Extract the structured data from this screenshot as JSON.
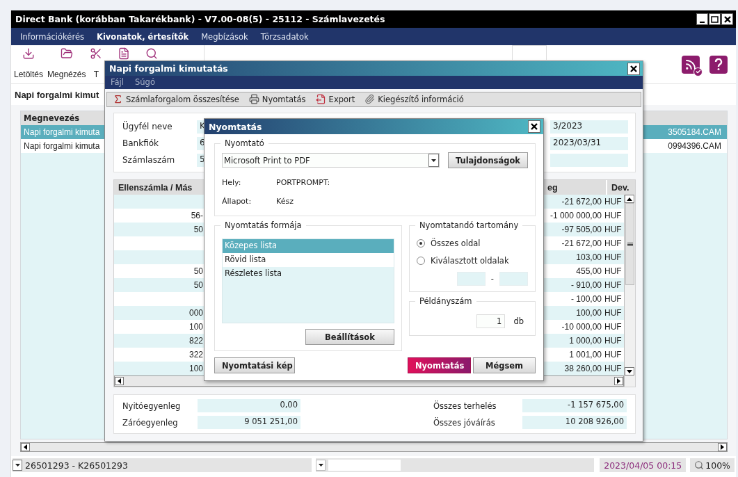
{
  "window": {
    "title": "Direct Bank (korábban Takarékbank) - V7.00-08(5) - 25112 - Számlavezetés"
  },
  "menu": [
    {
      "label": "Információkérés",
      "selected": false
    },
    {
      "label": "Kivonatok, értesítők",
      "selected": true
    },
    {
      "label": "Megbízások",
      "selected": false
    },
    {
      "label": "Törzsadatok",
      "selected": false
    }
  ],
  "toolbar": [
    {
      "kind": "download",
      "label": "Letöltés"
    },
    {
      "kind": "folder",
      "label": "Megnézés"
    },
    {
      "kind": "cut",
      "label": "T"
    },
    {
      "kind": "document"
    },
    {
      "kind": "search"
    }
  ],
  "section_title": "Napi forgalmi kimut",
  "list": {
    "columns": [
      "Megnevezés"
    ],
    "rows": [
      {
        "name": "Napi forgalmi kimuta",
        "file": "3505184.CAM",
        "selected": true
      },
      {
        "name": "Napi forgalmi kimuta",
        "file": "0994396.CAM",
        "selected": false
      }
    ]
  },
  "status_bar": {
    "account": "26501293 - K26501293",
    "datetime": "2023/04/05 00:15",
    "zoom": "100%"
  },
  "report_window": {
    "title": "Napi forgalmi kimutatás",
    "menu": [
      "Fájl",
      "Súgó"
    ],
    "toolbar": [
      {
        "kind": "sum",
        "label": "Számlaforgalom összesítése"
      },
      {
        "kind": "print",
        "label": "Nyomtatás"
      },
      {
        "kind": "export",
        "label": "Export"
      },
      {
        "kind": "attach",
        "label": "Kiegészítő információ"
      }
    ],
    "info": [
      {
        "label": "Ügyfél neve",
        "value": "K",
        "right": "3/2023"
      },
      {
        "label": "Bankfiók",
        "value": "6",
        "right": "2023/03/31"
      },
      {
        "label": "Számlaszám",
        "value": "5"
      }
    ],
    "table": {
      "columns": [
        "Ellenszámla / Más",
        "eg",
        "Dev."
      ],
      "rows": [
        {
          "account": "",
          "amount": "-21 672,00",
          "currency": "HUF"
        },
        {
          "account": "56-",
          "amount": "-1 000 000,00",
          "currency": "HUF"
        },
        {
          "account": "50",
          "amount": "-97 505,00",
          "currency": "HUF"
        },
        {
          "account": "",
          "amount": "-21 672,00",
          "currency": "HUF"
        },
        {
          "account": "",
          "amount": "103,00",
          "currency": "HUF"
        },
        {
          "account": "50",
          "amount": "455,00",
          "currency": "HUF"
        },
        {
          "account": "50",
          "amount": "- 910,00",
          "currency": "HUF"
        },
        {
          "account": "",
          "amount": "- 100,00",
          "currency": "HUF"
        },
        {
          "account": "000",
          "amount": "100,00",
          "currency": "HUF"
        },
        {
          "account": "100",
          "amount": "-10 000,00",
          "currency": "HUF"
        },
        {
          "account": "822",
          "amount": "1 000,00",
          "currency": "HUF"
        },
        {
          "account": "322",
          "amount": "1 001,00",
          "currency": "HUF"
        },
        {
          "account": "100",
          "amount": "38 260,00",
          "currency": "HUF"
        }
      ]
    },
    "summary": [
      {
        "label": "Nyitóegyenleg",
        "value": "0,00"
      },
      {
        "label": "Záróegyenleg",
        "value": "9 051 251,00"
      },
      {
        "label": "Összes terhelés",
        "value": "-1 157 675,00"
      },
      {
        "label": "Összes jóváírás",
        "value": "10 208 926,00"
      }
    ]
  },
  "print_dialog": {
    "title": "Nyomtatás",
    "printer": {
      "legend": "Nyomtató",
      "selected_printer": "Microsoft Print to PDF",
      "properties_button": "Tulajdonságok",
      "details": [
        {
          "label": "Hely:",
          "value": "PORTPROMPT:"
        },
        {
          "label": "Állapot:",
          "value": "Kész"
        }
      ]
    },
    "format": {
      "legend": "Nyomtatás formája",
      "options": [
        {
          "label": "Közepes lista",
          "selected": true
        },
        {
          "label": "Rövid lista",
          "selected": false
        },
        {
          "label": "Részletes lista",
          "selected": false
        }
      ],
      "settings_button": "Beállítások"
    },
    "range": {
      "legend": "Nyomtatandó tartomány",
      "options": [
        {
          "label": "Összes oldal",
          "selected": true
        },
        {
          "label": "Kiválasztott oldalak",
          "selected": false
        }
      ],
      "separator": "-"
    },
    "copies": {
      "legend": "Példányszám",
      "value": "1",
      "unit": "db"
    },
    "buttons": [
      {
        "kind": "preview",
        "label": "Nyomtatási kép"
      },
      {
        "kind": "primary",
        "label": "Nyomtatás"
      },
      {
        "kind": "cancel",
        "label": "Mégsem"
      }
    ]
  }
}
